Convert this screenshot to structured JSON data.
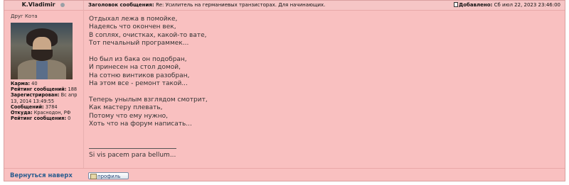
{
  "post": {
    "author": "K.Vladimir",
    "rank": "Друг Кота",
    "subject_label": "Заголовок сообщения:",
    "subject": "Re: Усилитель на германиевых транзисторах. Для начинающих.",
    "added_label": "Добавлено:",
    "added_date": "Сб июл 22, 2023 23:46:00",
    "stats": [
      {
        "label": "Карма:",
        "value": "40"
      },
      {
        "label": "Рейтинг сообщений:",
        "value": "188"
      },
      {
        "label": "Зарегистрирован:",
        "value": "Вс апр 13, 2014 13:49:55"
      },
      {
        "label": "Сообщений:",
        "value": "3784"
      },
      {
        "label": "Откуда:",
        "value": "Краснодон, РФ"
      },
      {
        "label": "Рейтинг сообщения:",
        "value": "0"
      }
    ],
    "lines": [
      "Отдыхал лежа в помойке,",
      "Надеясь что окончен век,",
      "В соплях, очистках, какой-то вате,",
      "Тот печальный программек...",
      "",
      "Но был из бака он подобран,",
      "И принесен на стол домой,",
      "На сотню винтиков разобран,",
      "На этом все - ремонт такой...",
      "",
      "Теперь унылым взглядом смотрит,",
      "Как мастеру плевать,",
      "Потому что ему нужно,",
      "Хоть что на форум написать..."
    ],
    "signature": "Si vis pacem para bellum..."
  },
  "footer": {
    "back_to_top": "Вернуться наверх",
    "profile_button": "профиль"
  },
  "colors": {
    "background": "#f9c0c0",
    "link": "#2a5d8f"
  }
}
